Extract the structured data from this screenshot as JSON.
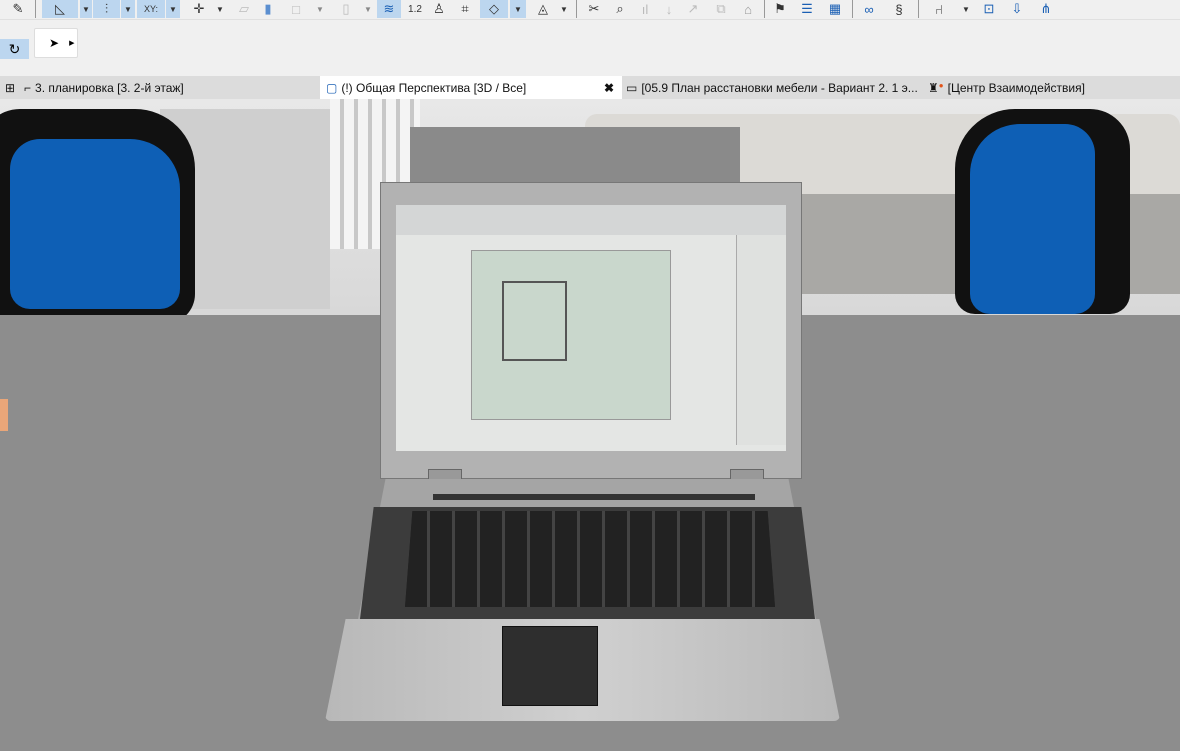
{
  "toolbar": {
    "icons": [
      "pencil-icon",
      "angle-tool-icon",
      "dropdown",
      "guide-line-icon",
      "dropdown",
      "xy-coordinates-icon",
      "dropdown",
      "snap-cross-icon",
      "dropdown",
      "slab-icon",
      "wall-icon",
      "box-icon",
      "dropdown",
      "door-icon",
      "dropdown",
      "layers-icon",
      "dimension-icon",
      "person-icon",
      "group-icon",
      "eraser-icon",
      "dropdown",
      "trace-icon",
      "dropdown",
      "scissors-icon",
      "magnify-icon",
      "chart-icon",
      "arrow-icon",
      "curve-icon",
      "export-icon",
      "house-icon",
      "flag-icon",
      "list-icon",
      "calendar-icon",
      "link-icon",
      "split-icon",
      "chair-icon",
      "dropdown",
      "connect-icon",
      "download-icon",
      "hierarchy-icon"
    ],
    "dimension_label": "1.2",
    "xy_label": "XY:"
  },
  "toolbar2": {
    "tool": "arrow-select-icon",
    "magic": "magic-wand-icon"
  },
  "tabs": [
    {
      "label": "3. планировка [3. 2-й этаж]",
      "icon": "floor-plan-icon"
    },
    {
      "label": "(!) Общая Перспектива [3D / Все]",
      "icon": "3d-window-icon",
      "active": true
    },
    {
      "label": "[05.9 План расстановки мебели - Вариант 2. 1 э...",
      "icon": "layout-icon"
    },
    {
      "label": "[Центр Взаимодействия]",
      "icon": "lighthouse-icon"
    }
  ],
  "colors": {
    "chair": "#0e5fb5",
    "table": "#8d8d8d",
    "accent": "#bcd6ef"
  }
}
